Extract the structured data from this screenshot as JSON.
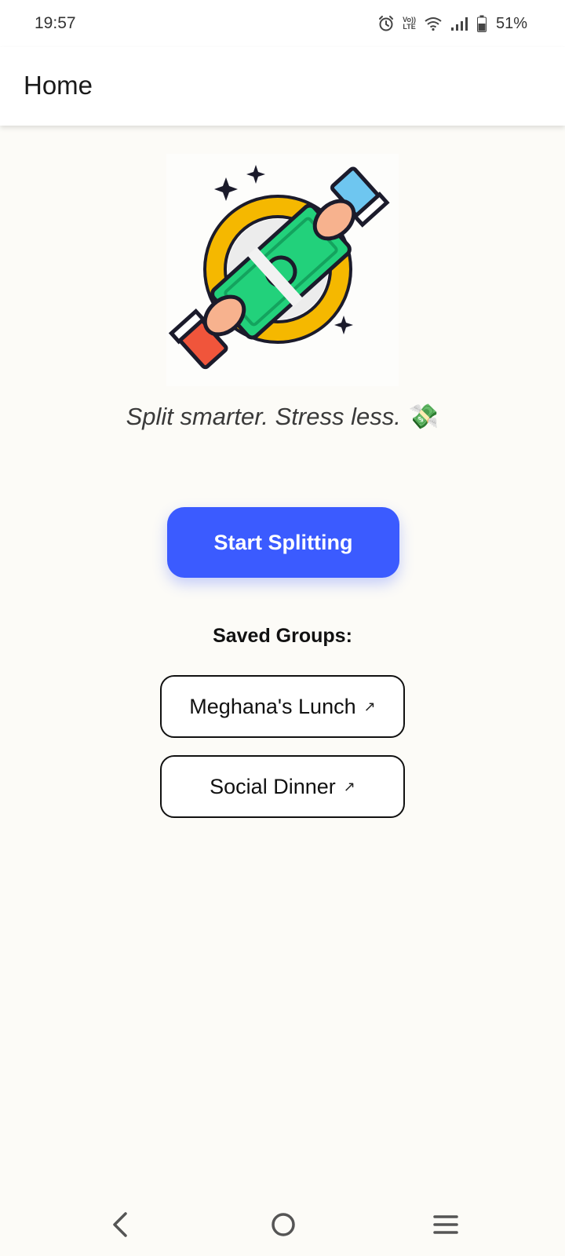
{
  "status_bar": {
    "time": "19:57",
    "battery_percent": "51%",
    "network_badge_top": "Vo))",
    "network_badge_bottom": "LTE",
    "icons": [
      "alarm-icon",
      "volte-icon",
      "wifi-icon",
      "signal-icon",
      "battery-icon"
    ]
  },
  "app_bar": {
    "title": "Home"
  },
  "hero": {
    "illustration": "money-exchange-illustration",
    "colors": {
      "ring": "#F5B800",
      "bill": "#22D17B",
      "sleeve_blue": "#6EC6F0",
      "sleeve_red": "#F0553B",
      "hand": "#F7B28E"
    }
  },
  "tagline": {
    "text": "Split smarter. Stress less.",
    "emoji": "💸"
  },
  "start_button": {
    "label": "Start Splitting",
    "color": "#3B5BFF"
  },
  "saved_groups": {
    "heading": "Saved Groups:",
    "items": [
      {
        "label": "Meghana's Lunch",
        "arrow": "↗"
      },
      {
        "label": "Social Dinner",
        "arrow": "↗"
      }
    ]
  },
  "nav_bar": {
    "icons": [
      "back-icon",
      "home-icon",
      "recents-icon"
    ]
  }
}
